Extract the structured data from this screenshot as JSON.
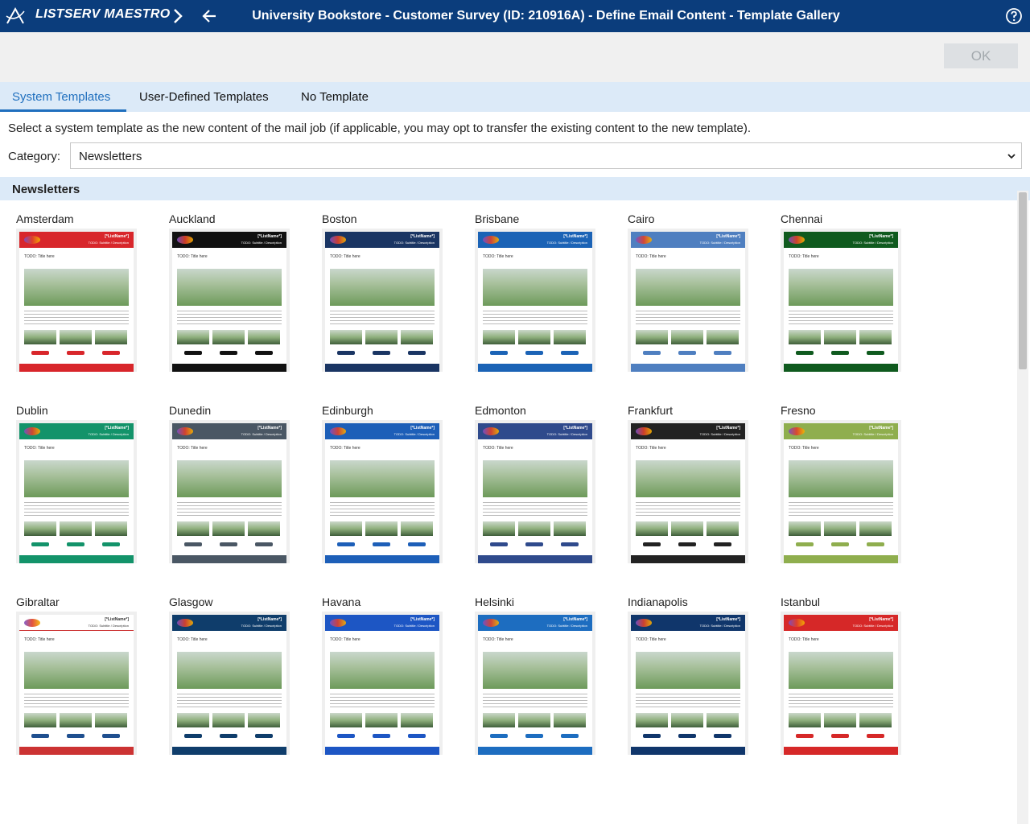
{
  "header": {
    "brand": "LISTSERV MAESTRO",
    "title": "University Bookstore - Customer Survey (ID: 210916A) - Define Email Content - Template Gallery",
    "bg_color": "#0b3d7c"
  },
  "toolbar": {
    "ok_label": "OK"
  },
  "tabs": [
    {
      "label": "System Templates",
      "active": true
    },
    {
      "label": "User-Defined Templates",
      "active": false
    },
    {
      "label": "No Template",
      "active": false
    }
  ],
  "description": "Select a system template as the new content of the mail job (if applicable, you may opt to transfer the existing content to the new template).",
  "category": {
    "label": "Category:",
    "value": "Newsletters"
  },
  "section": {
    "title": "Newsletters"
  },
  "templates": [
    {
      "name": "Amsterdam",
      "color": "#d8262b"
    },
    {
      "name": "Auckland",
      "color": "#111111"
    },
    {
      "name": "Boston",
      "color": "#1a3563"
    },
    {
      "name": "Brisbane",
      "color": "#1b63b6"
    },
    {
      "name": "Cairo",
      "color": "#4f7fc0"
    },
    {
      "name": "Chennai",
      "color": "#0f5a1e"
    },
    {
      "name": "Dublin",
      "color": "#13936a"
    },
    {
      "name": "Dunedin",
      "color": "#4a5764"
    },
    {
      "name": "Edinburgh",
      "color": "#1d5fb8"
    },
    {
      "name": "Edmonton",
      "color": "#2f4a8c"
    },
    {
      "name": "Frankfurt",
      "color": "#222222"
    },
    {
      "name": "Fresno",
      "color": "#8fae4e"
    },
    {
      "name": "Gibraltar",
      "color": "#ffffff"
    },
    {
      "name": "Glasgow",
      "color": "#0f3d6b"
    },
    {
      "name": "Havana",
      "color": "#1d56c4"
    },
    {
      "name": "Helsinki",
      "color": "#1d6dc0"
    },
    {
      "name": "Indianapolis",
      "color": "#10366b"
    },
    {
      "name": "Istanbul",
      "color": "#d62828"
    }
  ],
  "template_placeholder": {
    "listname": "[*ListName*]",
    "subtitle": "TODO: Subtitle / Description",
    "title": "TODO: Title here"
  }
}
